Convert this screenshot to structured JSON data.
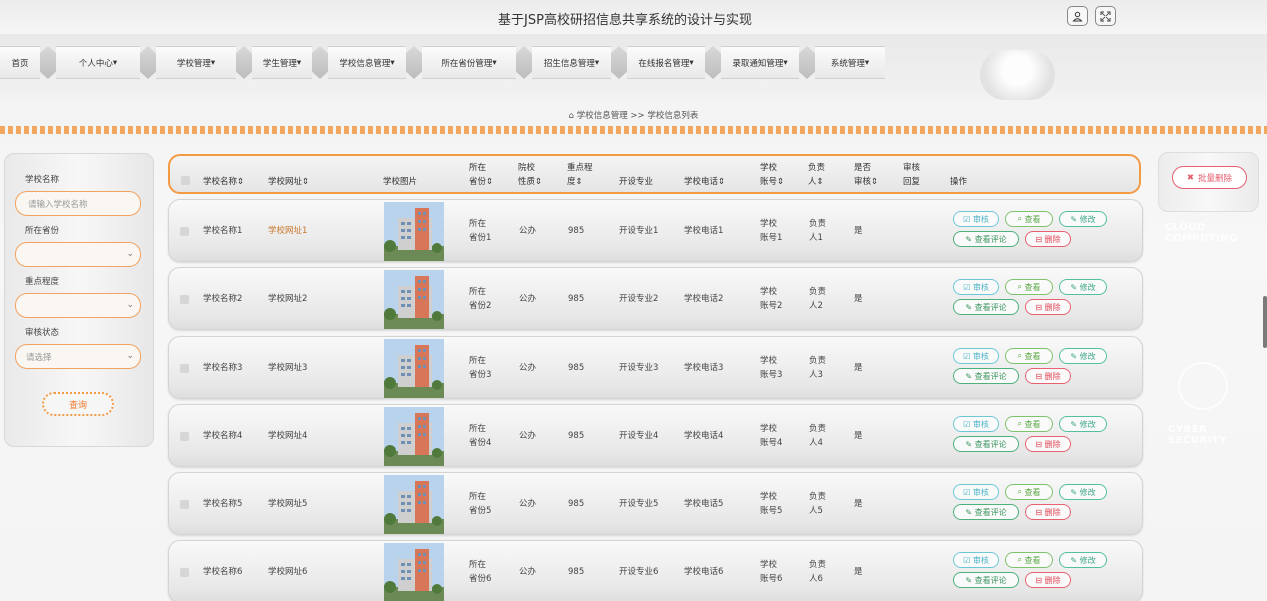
{
  "header": {
    "title": "基于JSP高校研招信息共享系统的设计与实现"
  },
  "nav": [
    "首页",
    "个人中心",
    "学校管理",
    "学生管理",
    "学校信息管理",
    "所在省份管理",
    "招生信息管理",
    "在线报名管理",
    "录取通知管理",
    "系统管理"
  ],
  "breadcrumb": {
    "path": "学校信息管理 >> 学校信息列表"
  },
  "search": {
    "school_name_label": "学校名称",
    "school_name_placeholder": "请输入学校名称",
    "province_label": "所在省份",
    "province_value": "",
    "importance_label": "重点程度",
    "importance_value": "",
    "review_label": "审核状态",
    "review_value": "请选择",
    "query_button": "查询"
  },
  "actions": {
    "batch_delete": "批量删除"
  },
  "side_texts": {
    "cloud": "CLOUD COMPUTING",
    "cyber": "CYBER SECURITY"
  },
  "table": {
    "headers": {
      "school_name": "学校名称",
      "school_site": "学校网址",
      "school_image": "学校图片",
      "province": [
        "所在",
        "省份"
      ],
      "nature": [
        "院校",
        "性质"
      ],
      "importance": [
        "重点程",
        "度"
      ],
      "majors": "开设专业",
      "phone": "学校电话",
      "account": [
        "学校",
        "账号"
      ],
      "leader": [
        "负责",
        "人"
      ],
      "reviewed": [
        "是否",
        "审核"
      ],
      "reply": [
        "审核",
        "回复"
      ],
      "ops": "操作"
    },
    "op_labels": {
      "review": "审核",
      "view": "查看",
      "edit": "修改",
      "comments": "查看评论",
      "delete": "删除"
    },
    "rows": [
      {
        "school_name": "学校名称1",
        "school_site": "学校网址1",
        "province": [
          "所在",
          "省份1"
        ],
        "nature": "公办",
        "importance": "985",
        "majors": "开设专业1",
        "phone": "学校电话1",
        "account": [
          "学校",
          "账号1"
        ],
        "leader": [
          "负责",
          "人1"
        ],
        "reviewed": "是",
        "reply": ""
      },
      {
        "school_name": "学校名称2",
        "school_site": "学校网址2",
        "province": [
          "所在",
          "省份2"
        ],
        "nature": "公办",
        "importance": "985",
        "majors": "开设专业2",
        "phone": "学校电话2",
        "account": [
          "学校",
          "账号2"
        ],
        "leader": [
          "负责",
          "人2"
        ],
        "reviewed": "是",
        "reply": ""
      },
      {
        "school_name": "学校名称3",
        "school_site": "学校网址3",
        "province": [
          "所在",
          "省份3"
        ],
        "nature": "公办",
        "importance": "985",
        "majors": "开设专业3",
        "phone": "学校电话3",
        "account": [
          "学校",
          "账号3"
        ],
        "leader": [
          "负责",
          "人3"
        ],
        "reviewed": "是",
        "reply": ""
      },
      {
        "school_name": "学校名称4",
        "school_site": "学校网址4",
        "province": [
          "所在",
          "省份4"
        ],
        "nature": "公办",
        "importance": "985",
        "majors": "开设专业4",
        "phone": "学校电话4",
        "account": [
          "学校",
          "账号4"
        ],
        "leader": [
          "负责",
          "人4"
        ],
        "reviewed": "是",
        "reply": ""
      },
      {
        "school_name": "学校名称5",
        "school_site": "学校网址5",
        "province": [
          "所在",
          "省份5"
        ],
        "nature": "公办",
        "importance": "985",
        "majors": "开设专业5",
        "phone": "学校电话5",
        "account": [
          "学校",
          "账号5"
        ],
        "leader": [
          "负责",
          "人5"
        ],
        "reviewed": "是",
        "reply": ""
      },
      {
        "school_name": "学校名称6",
        "school_site": "学校网址6",
        "province": [
          "所在",
          "省份6"
        ],
        "nature": "公办",
        "importance": "985",
        "majors": "开设专业6",
        "phone": "学校电话6",
        "account": [
          "学校",
          "账号6"
        ],
        "leader": [
          "负责",
          "人6"
        ],
        "reviewed": "是",
        "reply": ""
      }
    ]
  },
  "colors": {
    "accent": "#f39a45",
    "danger": "#e35f6f",
    "link": "#c8782b"
  }
}
